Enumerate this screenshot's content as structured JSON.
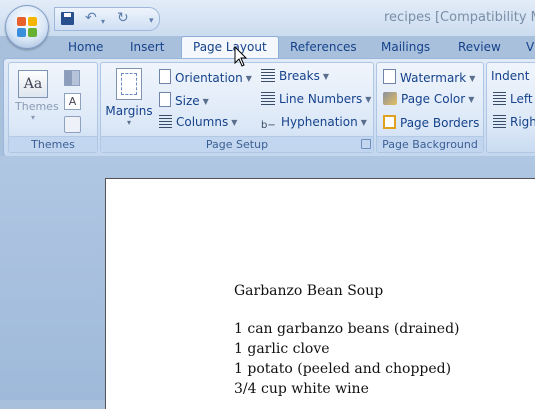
{
  "window": {
    "title": "recipes [Compatibility M"
  },
  "quick_access": {
    "save_icon": "save-icon",
    "undo_icon": "undo-icon",
    "redo_icon": "redo-icon",
    "customize_icon": "customize-qat-icon"
  },
  "tabs": [
    {
      "label": "Home"
    },
    {
      "label": "Insert"
    },
    {
      "label": "Page Layout",
      "active": true
    },
    {
      "label": "References"
    },
    {
      "label": "Mailings"
    },
    {
      "label": "Review"
    },
    {
      "label": "V"
    }
  ],
  "ribbon": {
    "themes": {
      "group_label": "Themes",
      "themes_button": "Themes",
      "colors_icon": "theme-colors-icon",
      "fonts_icon": "theme-fonts-icon",
      "effects_icon": "theme-effects-icon"
    },
    "page_setup": {
      "group_label": "Page Setup",
      "margins": "Margins",
      "orientation": "Orientation",
      "size": "Size",
      "columns": "Columns",
      "breaks": "Breaks",
      "line_numbers": "Line Numbers",
      "hyphenation": "Hyphenation"
    },
    "page_background": {
      "group_label": "Page Background",
      "watermark": "Watermark",
      "page_color": "Page Color",
      "page_borders": "Page Borders"
    },
    "paragraph": {
      "indent": "Indent",
      "left": "Left",
      "right": "Righ"
    }
  },
  "document": {
    "lines": [
      "Garbanzo Bean Soup",
      "1 can garbanzo beans (drained)",
      "1 garlic clove",
      "1 potato (peeled and chopped)",
      "3/4 cup white wine"
    ]
  },
  "colors": {
    "ribbon_text": "#15428b",
    "accent": "#f7b500"
  }
}
